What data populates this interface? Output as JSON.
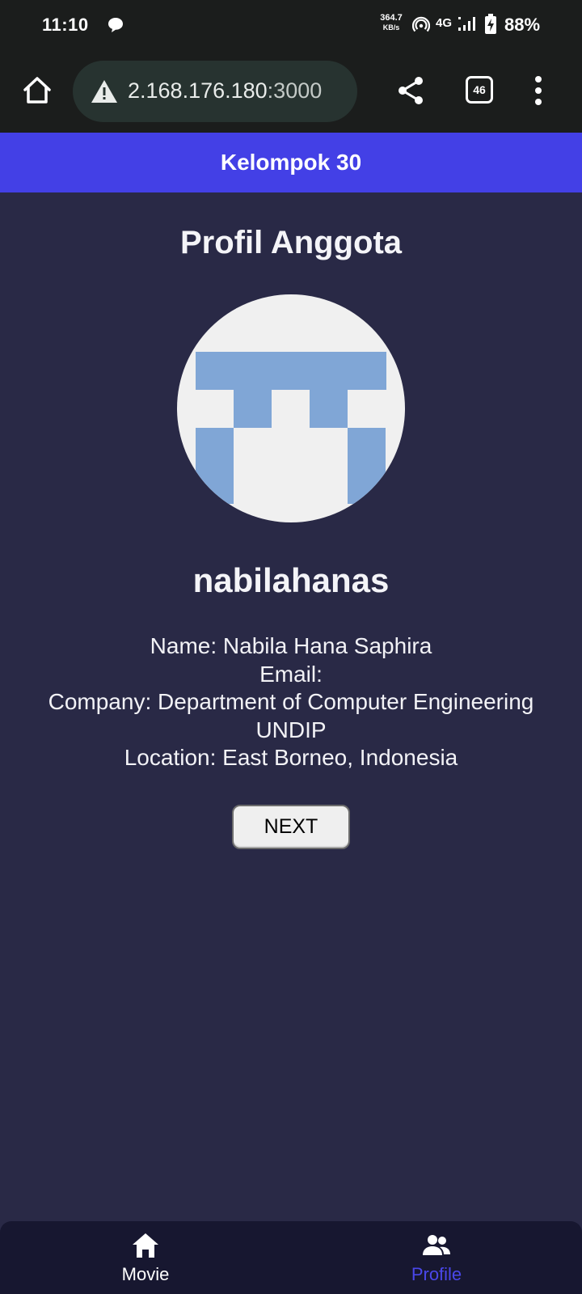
{
  "status_bar": {
    "time": "11:10",
    "speed_value": "364.7",
    "speed_unit": "KB/s",
    "network": "4G",
    "battery": "88%"
  },
  "browser": {
    "url_host": "2.168.176.180",
    "url_port": ":3000",
    "tab_count": "46"
  },
  "app": {
    "header_title": "Kelompok 30",
    "page_title": "Profil Anggota"
  },
  "profile": {
    "username": "nabilahanas",
    "name_line": "Name: Nabila Hana Saphira",
    "email_line": "Email:",
    "company_line": "Company: Department of Computer Engineering UNDIP",
    "location_line": "Location: East Borneo, Indonesia",
    "next_label": "NEXT",
    "avatar_colors": {
      "background": "#f0f0f0",
      "pattern": "#80a6d6"
    }
  },
  "bottom_nav": {
    "items": [
      {
        "label": "Movie",
        "icon": "home-icon",
        "active": false
      },
      {
        "label": "Profile",
        "icon": "people-icon",
        "active": true
      }
    ],
    "active_color": "#4a47ea"
  }
}
